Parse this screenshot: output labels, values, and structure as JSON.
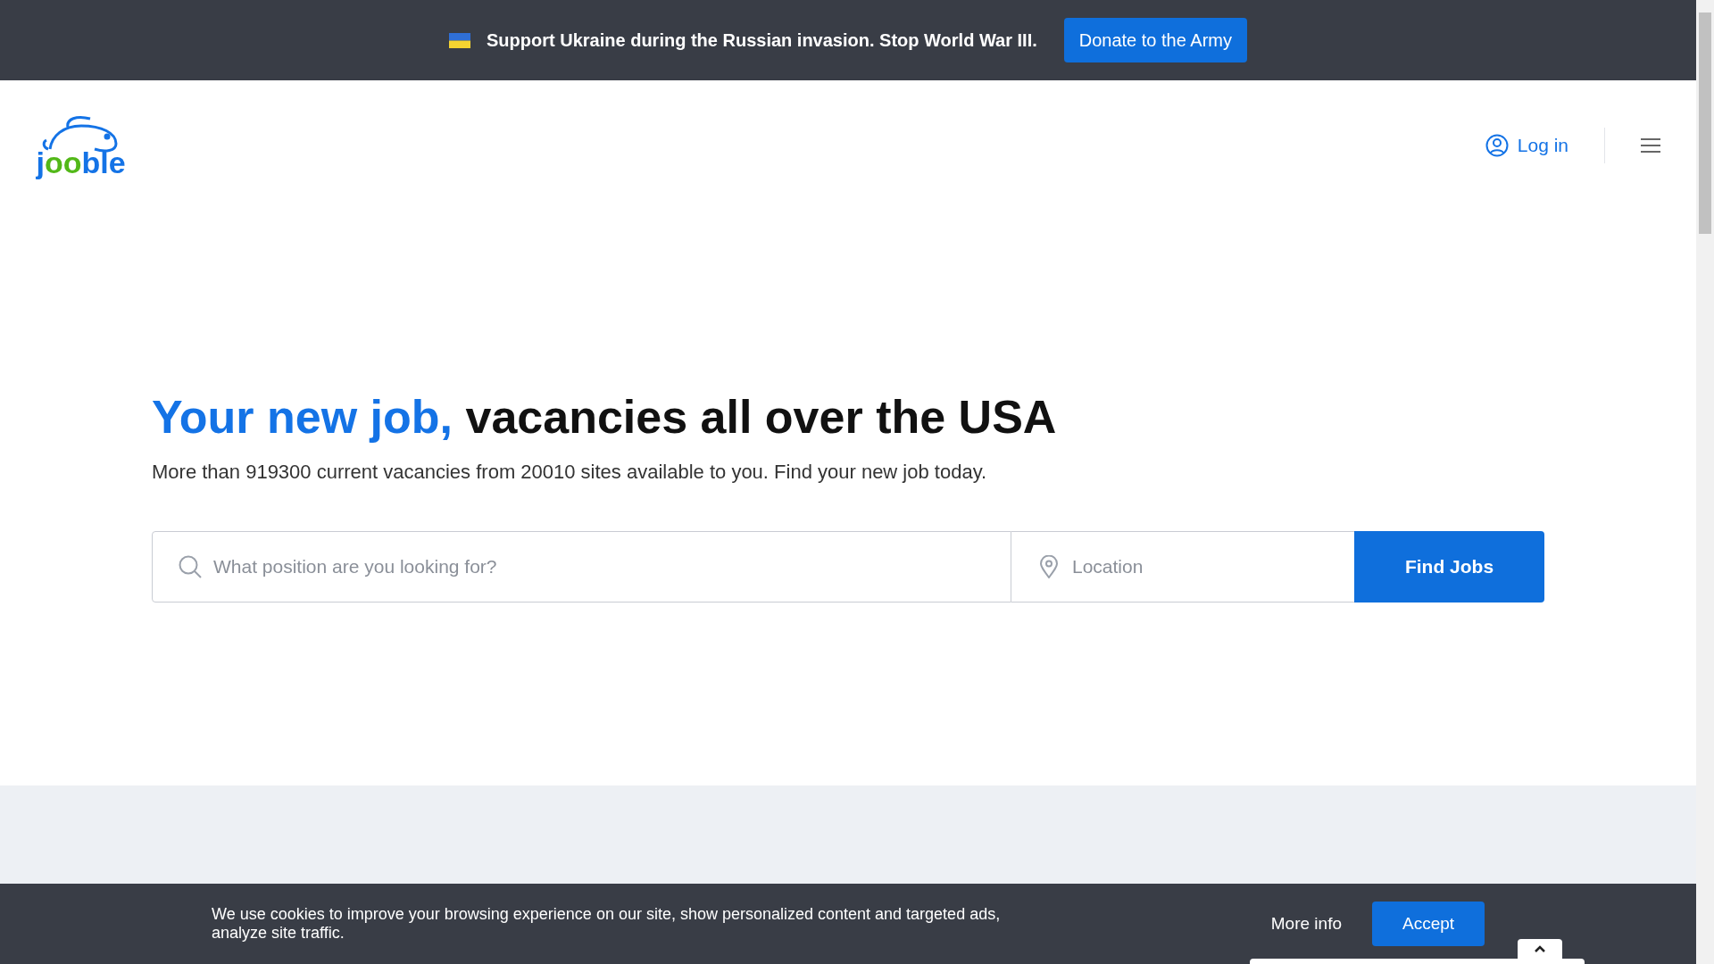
{
  "banner": {
    "message": "Support Ukraine during the Russian invasion. Stop World War III.",
    "button": "Donate to the Army"
  },
  "header": {
    "logo": [
      {
        "text": "j",
        "color": "#1473e6"
      },
      {
        "text": "oo",
        "color": "#52b818"
      },
      {
        "text": "ble",
        "color": "#1473e6"
      }
    ],
    "login": "Log in"
  },
  "hero": {
    "title_accent": "Your new job,",
    "title_rest": "vacancies all over the USA",
    "subtitle": "More than 919300 current vacancies from 20010 sites available to you. Find your new job today."
  },
  "search": {
    "position_placeholder": "What position are you looking for?",
    "location_placeholder": "Location",
    "button": "Find Jobs"
  },
  "cookie_bar": {
    "message": "We use cookies to improve your browsing experience on our site, show personalized content and targeted ads, analyze site traffic.",
    "more_info": "More info",
    "accept": "Accept"
  }
}
